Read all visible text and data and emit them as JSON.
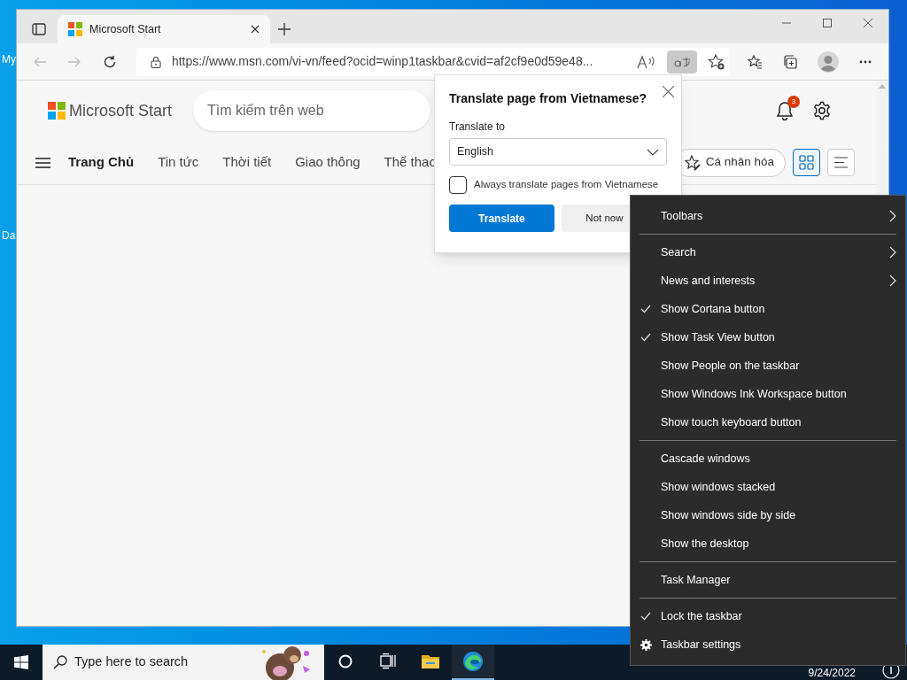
{
  "desktop_labels": [
    "My",
    "Da"
  ],
  "browser": {
    "tabs": [
      {
        "title": "Microsoft Start",
        "selected": true
      }
    ],
    "address": "https://www.msn.com/vi-vn/feed?ocid=winp1taskbar&cvid=af2cf9e0d59e48...",
    "translate_active": true
  },
  "page": {
    "logo": "Microsoft Start",
    "search": {
      "placeholder": "Tìm kiếm trên web"
    },
    "notification_count": "3",
    "nav": [
      {
        "label": "Trang Chủ",
        "selected": true
      },
      {
        "label": "Tin tức",
        "selected": false
      },
      {
        "label": "Thời tiết",
        "selected": false
      },
      {
        "label": "Giao thông",
        "selected": false
      },
      {
        "label": "Thể thao",
        "selected": false
      }
    ],
    "personalize": "Cá nhân hóa",
    "views": [
      {
        "kind": "grid",
        "selected": true
      },
      {
        "kind": "list",
        "selected": false
      }
    ]
  },
  "translate_popup": {
    "title": "Translate page from Vietnamese?",
    "label": "Translate to",
    "language": "English",
    "always": {
      "label": "Always translate pages from Vietnamese",
      "checked": false
    },
    "primary": "Translate",
    "secondary": "Not now"
  },
  "context_menu": [
    {
      "kind": "item",
      "label": "Toolbars",
      "checked": false,
      "submenu": true
    },
    {
      "kind": "separator"
    },
    {
      "kind": "item",
      "label": "Search",
      "checked": false,
      "submenu": true
    },
    {
      "kind": "item",
      "label": "News and interests",
      "checked": false,
      "submenu": true
    },
    {
      "kind": "item",
      "label": "Show Cortana button",
      "checked": true,
      "submenu": false
    },
    {
      "kind": "item",
      "label": "Show Task View button",
      "checked": true,
      "submenu": false
    },
    {
      "kind": "item",
      "label": "Show People on the taskbar",
      "checked": false,
      "submenu": false
    },
    {
      "kind": "item",
      "label": "Show Windows Ink Workspace button",
      "checked": false,
      "submenu": false
    },
    {
      "kind": "item",
      "label": "Show touch keyboard button",
      "checked": false,
      "submenu": false
    },
    {
      "kind": "separator"
    },
    {
      "kind": "item",
      "label": "Cascade windows",
      "checked": false,
      "submenu": false
    },
    {
      "kind": "item",
      "label": "Show windows stacked",
      "checked": false,
      "submenu": false
    },
    {
      "kind": "item",
      "label": "Show windows side by side",
      "checked": false,
      "submenu": false
    },
    {
      "kind": "item",
      "label": "Show the desktop",
      "checked": false,
      "submenu": false
    },
    {
      "kind": "separator"
    },
    {
      "kind": "item",
      "label": "Task Manager",
      "checked": false,
      "submenu": false
    },
    {
      "kind": "separator"
    },
    {
      "kind": "item",
      "label": "Lock the taskbar",
      "checked": true,
      "submenu": false
    },
    {
      "kind": "settings",
      "label": "Taskbar settings"
    }
  ],
  "taskbar": {
    "search_placeholder": "Type here to search",
    "apps": [
      {
        "kind": "cortana",
        "selected": false
      },
      {
        "kind": "taskview",
        "selected": false
      },
      {
        "kind": "explorer",
        "selected": false
      },
      {
        "kind": "edge",
        "selected": true
      }
    ],
    "date": "9/24/2022"
  }
}
